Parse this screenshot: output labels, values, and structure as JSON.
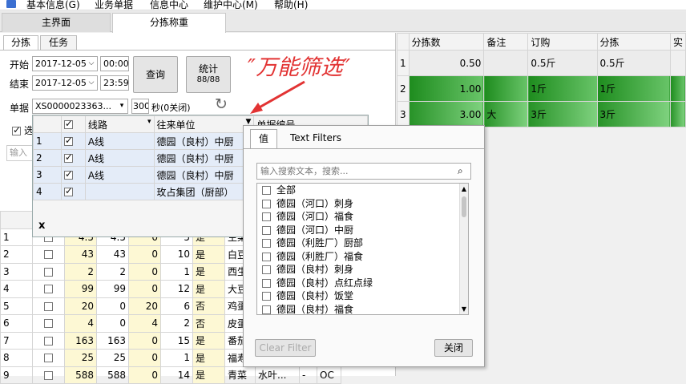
{
  "menu": {
    "items": [
      "基本信息(G)",
      "业务单据",
      "信息中心",
      "维护中心(M)",
      "帮助(H)"
    ]
  },
  "main_tabs": [
    "主界面",
    "分拣称重"
  ],
  "panel_tabs": [
    "分拣",
    "任务"
  ],
  "form": {
    "start_label": "开始",
    "start_date": "2017-12-05",
    "start_time": "00:00",
    "end_label": "结束",
    "end_date": "2017-12-05",
    "end_time": "23:59",
    "query_label": "查询",
    "stats_label": "统计",
    "stats_count": "88/88",
    "bill_label": "单据",
    "bill_value": "XS0000023363...",
    "seconds_value": "300",
    "seconds_label": "秒(0关闭)"
  },
  "annotation": "″万能筛选″",
  "right_grid": {
    "headers": [
      "分拣数",
      "备注",
      "订购",
      "分拣",
      "实"
    ],
    "rows": [
      {
        "idx": "1",
        "qty": "0.50",
        "note": "",
        "order": "0.5斤",
        "pick": "0.5斤"
      },
      {
        "idx": "2",
        "qty": "1.00",
        "note": "",
        "order": "1斤",
        "pick": "1斤"
      },
      {
        "idx": "3",
        "qty": "3.00",
        "note": "大",
        "order": "3斤",
        "pick": "3斤"
      }
    ]
  },
  "overlay_grid": {
    "headers": [
      "线路",
      "往来单位",
      "单据编号"
    ],
    "rows": [
      {
        "idx": "1",
        "route": "A线",
        "unit": "德园（良村）中厨"
      },
      {
        "idx": "2",
        "route": "A线",
        "unit": "德园（良村）中厨"
      },
      {
        "idx": "3",
        "route": "A线",
        "unit": "德园（良村）中厨"
      },
      {
        "idx": "4",
        "route": "",
        "unit": "玫占集团（厨部）"
      }
    ],
    "close_label": "x"
  },
  "left_partial": {
    "check_label": "选",
    "input_placeholder": "输入"
  },
  "left_grid": {
    "rows": [
      {
        "idx": "1",
        "a": "4.5",
        "b": "4.5",
        "c": "0",
        "d": "5",
        "e": "是",
        "f": "生菜"
      },
      {
        "idx": "2",
        "a": "43",
        "b": "43",
        "c": "0",
        "d": "10",
        "e": "是",
        "f": "白豆"
      },
      {
        "idx": "3",
        "a": "2",
        "b": "2",
        "c": "0",
        "d": "1",
        "e": "是",
        "f": "西生"
      },
      {
        "idx": "4",
        "a": "99",
        "b": "99",
        "c": "0",
        "d": "12",
        "e": "是",
        "f": "大豆"
      },
      {
        "idx": "5",
        "a": "20",
        "b": "0",
        "c": "20",
        "d": "6",
        "e": "否",
        "f": "鸡蛋"
      },
      {
        "idx": "6",
        "a": "4",
        "b": "0",
        "c": "4",
        "d": "2",
        "e": "否",
        "f": "皮蛋"
      },
      {
        "idx": "7",
        "a": "163",
        "b": "163",
        "c": "0",
        "d": "15",
        "e": "是",
        "f": "番茄"
      },
      {
        "idx": "8",
        "a": "25",
        "b": "25",
        "c": "0",
        "d": "1",
        "e": "是",
        "f": "福寿"
      },
      {
        "idx": "9",
        "a": "588",
        "b": "588",
        "c": "0",
        "d": "14",
        "e": "是",
        "f": "青菜",
        "g": "水叶...",
        "h": "-",
        "i": "OC"
      }
    ]
  },
  "filter": {
    "tab_values": "值",
    "tab_text": "Text Filters",
    "search_placeholder": "输入搜索文本，搜索...",
    "items": [
      "全部",
      "德园（河口）刺身",
      "德园（河口）福食",
      "德园（河口）中厨",
      "德园（利胜厂）厨部",
      "德园（利胜厂）福食",
      "德园（良村）刺身",
      "德园（良村）点红点绿",
      "德园（良村）饭堂",
      "德园（良村）福食"
    ],
    "clear_label": "Clear Filter",
    "close_label": "关闭"
  },
  "colors": {
    "green_dark": "#1e8c1e",
    "green_light": "#7fd27f",
    "annotation_red": "#e23333",
    "overlay_selection": "#e4ecf8"
  }
}
